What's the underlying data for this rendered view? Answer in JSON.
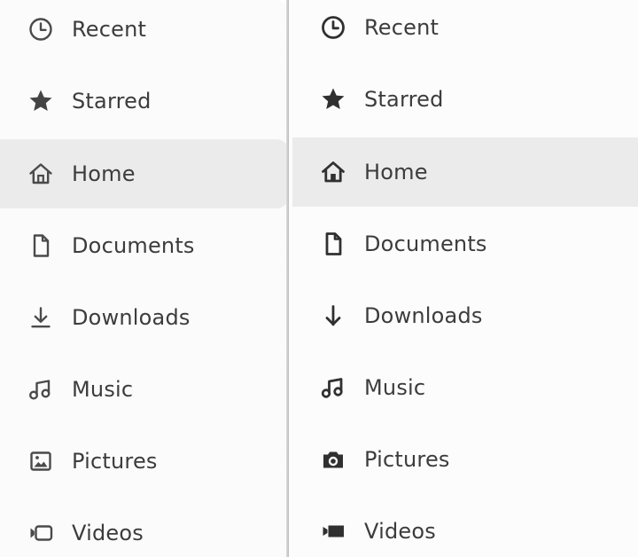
{
  "left_sidebar": {
    "items": [
      {
        "label": "Recent",
        "icon": "clock-icon"
      },
      {
        "label": "Starred",
        "icon": "star-icon"
      },
      {
        "label": "Home",
        "icon": "home-icon"
      },
      {
        "label": "Documents",
        "icon": "document-icon"
      },
      {
        "label": "Downloads",
        "icon": "download-icon"
      },
      {
        "label": "Music",
        "icon": "music-icon"
      },
      {
        "label": "Pictures",
        "icon": "picture-icon"
      },
      {
        "label": "Videos",
        "icon": "video-icon"
      }
    ]
  },
  "right_sidebar": {
    "items": [
      {
        "label": "Recent",
        "icon": "clock-icon"
      },
      {
        "label": "Starred",
        "icon": "star-icon"
      },
      {
        "label": "Home",
        "icon": "home-icon"
      },
      {
        "label": "Documents",
        "icon": "document-icon"
      },
      {
        "label": "Downloads",
        "icon": "download-icon"
      },
      {
        "label": "Music",
        "icon": "music-icon"
      },
      {
        "label": "Pictures",
        "icon": "camera-icon"
      },
      {
        "label": "Videos",
        "icon": "video-camera-icon"
      }
    ]
  },
  "selected_item": "Home",
  "colors": {
    "text": "#3c3c3c",
    "selected_background": "#ebebeb",
    "panel_background": "#fafafa"
  }
}
